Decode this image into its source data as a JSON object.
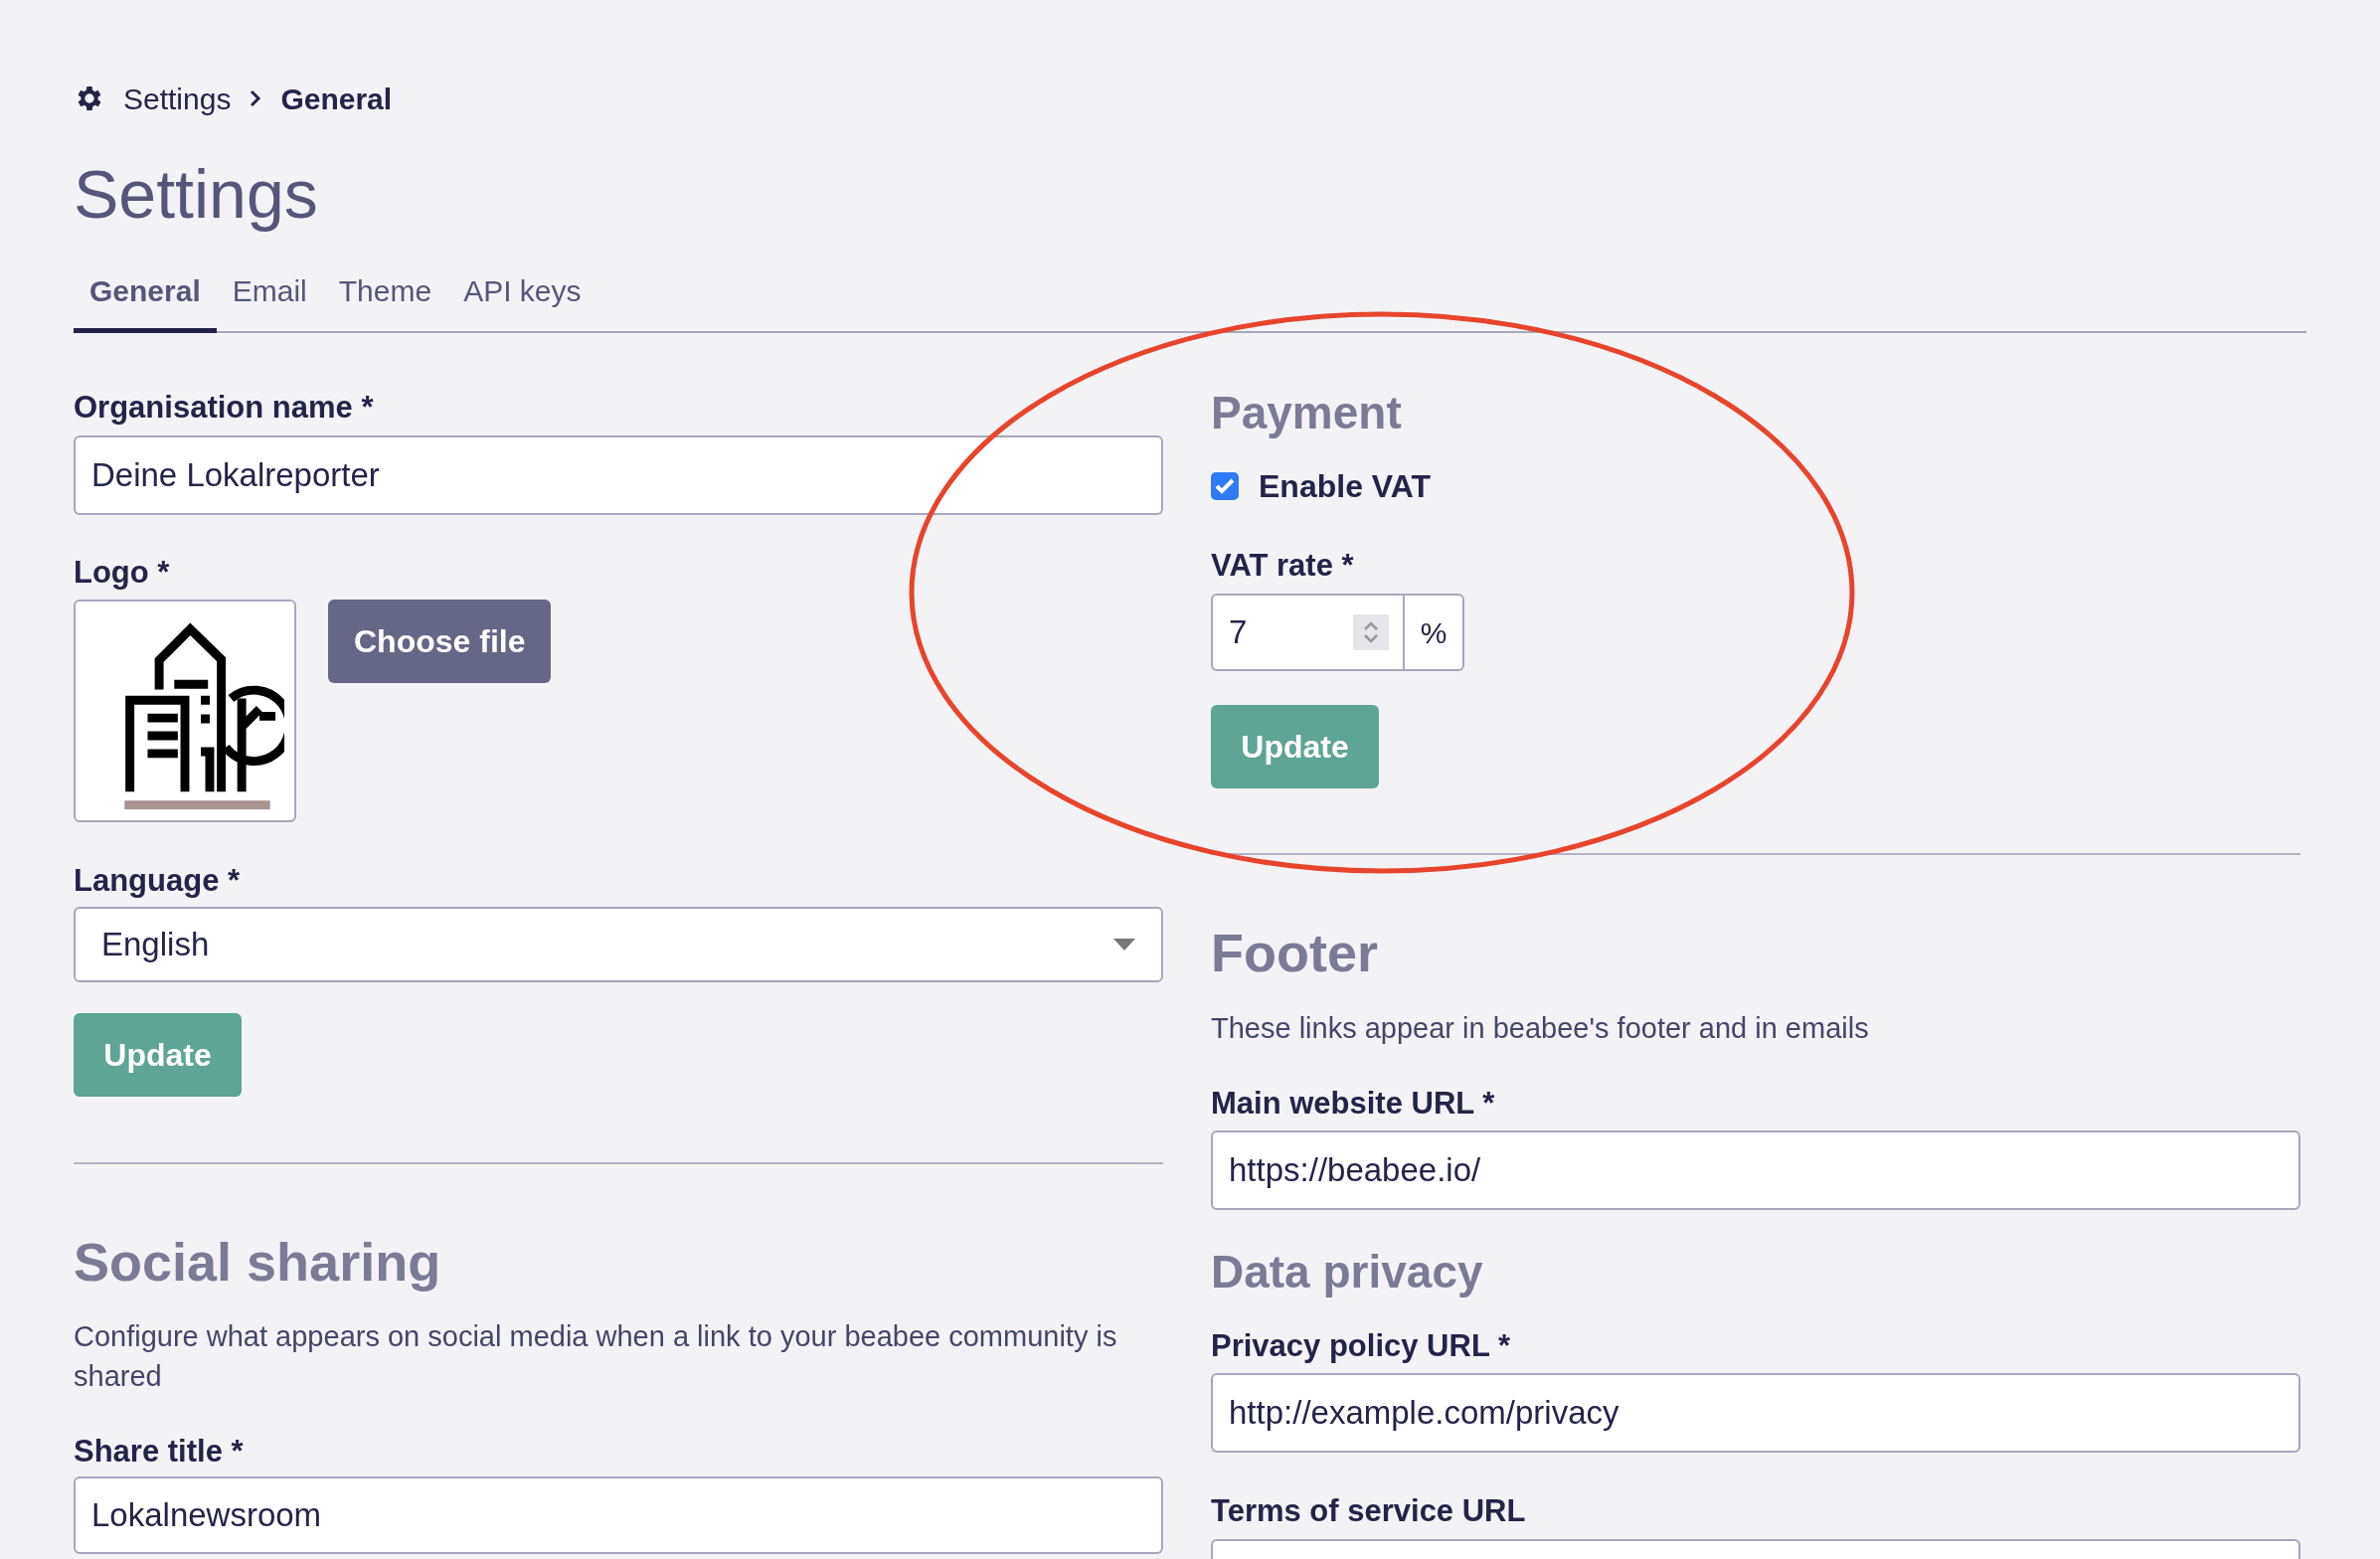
{
  "breadcrumb": [
    {
      "label": "Settings",
      "current": false
    },
    {
      "label": "General",
      "current": true
    }
  ],
  "title": "Settings",
  "tabs": [
    {
      "label": "General",
      "selected": true
    },
    {
      "label": "Email",
      "selected": false
    },
    {
      "label": "Theme",
      "selected": false
    },
    {
      "label": "API keys",
      "selected": false
    }
  ],
  "general": {
    "organisation_name": {
      "label": "Organisation name *",
      "value": "Deine Lokalreporter"
    },
    "logo": {
      "label": "Logo *",
      "button": "Choose file"
    },
    "language": {
      "label": "Language *",
      "value": "English"
    },
    "button": "Update"
  },
  "social_sharing": {
    "heading": "Social sharing",
    "description": "Configure what appears on social media when a link to your beabee community is shared",
    "share_title": {
      "label": "Share title *",
      "value": "Lokalnewsroom"
    }
  },
  "payment": {
    "heading": "Payment",
    "enable_vat": {
      "label": "Enable VAT",
      "checked": true
    },
    "vat_rate": {
      "label": "VAT rate *",
      "value": "7",
      "suffix": "%"
    },
    "button": "Update"
  },
  "footer": {
    "heading": "Footer",
    "description": "These links appear in beabee's footer and in emails",
    "main_website_url": {
      "label": "Main website URL *",
      "value": "https://beabee.io/"
    }
  },
  "data_privacy": {
    "heading": "Data privacy",
    "privacy_policy_url": {
      "label": "Privacy policy URL *",
      "value": "http://example.com/privacy"
    },
    "terms_of_service_url": {
      "label": "Terms of service URL"
    }
  }
}
